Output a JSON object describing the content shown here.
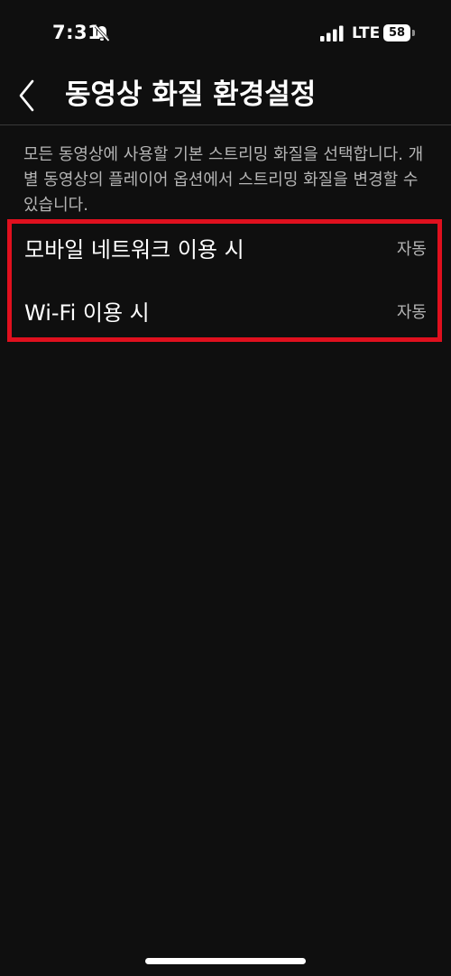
{
  "status_bar": {
    "time": "7:31",
    "network": "LTE",
    "battery": "58"
  },
  "header": {
    "title": "동영상 화질 환경설정"
  },
  "description": "모든 동영상에 사용할 기본 스트리밍 화질을 선택합니다. 개별 동영상의 플레이어 옵션에서 스트리밍 화질을 변경할 수 있습니다.",
  "settings": [
    {
      "label": "모바일 네트워크 이용 시",
      "value": "자동"
    },
    {
      "label": "Wi-Fi 이용 시",
      "value": "자동"
    }
  ],
  "icons": {
    "back": "chevron-left-icon",
    "mute": "bell-slash-icon",
    "signal": "signal-icon"
  },
  "colors": {
    "background": "#0f0f0f",
    "highlight": "#e0101e",
    "secondary_text": "#b5b5b5"
  }
}
